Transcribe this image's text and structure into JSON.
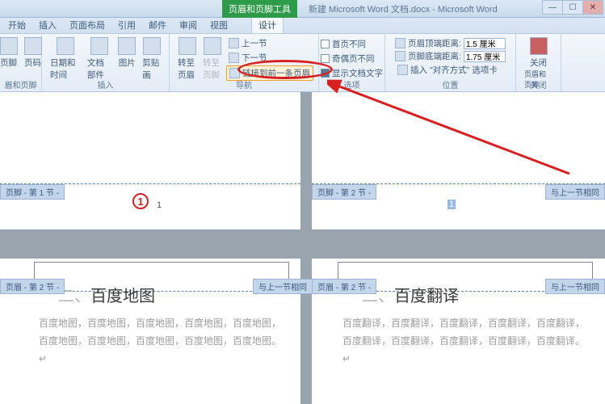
{
  "titlebar": {
    "context_tab": "页眉和页脚工具",
    "doc_title": "新建 Microsoft Word 文档.docx - Microsoft Word"
  },
  "tabs": [
    "开始",
    "插入",
    "页面布局",
    "引用",
    "邮件",
    "审阅",
    "视图",
    "设计"
  ],
  "active_tab": 7,
  "ribbon": {
    "g1": {
      "label": "眉和页脚",
      "btn1": "页脚",
      "btn2": "页码"
    },
    "g2": {
      "label": "插入",
      "btn1": "日期和时间",
      "btn2": "文档部件",
      "btn3": "图片",
      "btn4": "剪贴画"
    },
    "g3": {
      "label": "导航",
      "btn1": "转至页眉",
      "btn2": "转至页脚",
      "prev": "上一节",
      "next": "下一节",
      "link": "链接到前一条页眉"
    },
    "g4": {
      "label": "选项",
      "c1": "首页不同",
      "c2": "奇偶页不同",
      "c3": "显示文档文字"
    },
    "g5": {
      "label": "位置",
      "r1": "页眉顶端距离:",
      "v1": "1.5 厘米",
      "r2": "页脚底端距离:",
      "v2": "1.75 厘米",
      "r3": "插入 \"对齐方式\" 选项卡"
    },
    "g6": {
      "label": "关闭",
      "btn": "关闭",
      "btn2": "页眉和页脚"
    }
  },
  "annot": {
    "num": "1"
  },
  "doc": {
    "p1": {
      "tab": "页脚 - 第 1 节 -",
      "num": "1"
    },
    "p2": {
      "tab": "页脚 - 第 2 节 -",
      "tab2": "与上一节相同",
      "num": "1"
    },
    "p3": {
      "tab": "页眉 - 第 2 节 -",
      "tab2": "与上一节相同",
      "heading_pre": "二、",
      "heading": "百度地图",
      "text": "百度地图，百度地图，百度地图，百度地图，百度地图，百度地图，百度地图，百度地图，百度地图，百度地图。↵"
    },
    "p4": {
      "tab": "页眉 - 第 2 节 -",
      "tab2": "与上一节相同",
      "heading_pre": "二、",
      "heading": "百度翻译",
      "text": "百度翻译，百度翻译，百度翻译，百度翻译，百度翻译，百度翻译，百度翻译，百度翻译，百度翻译，百度翻译。↵"
    }
  }
}
